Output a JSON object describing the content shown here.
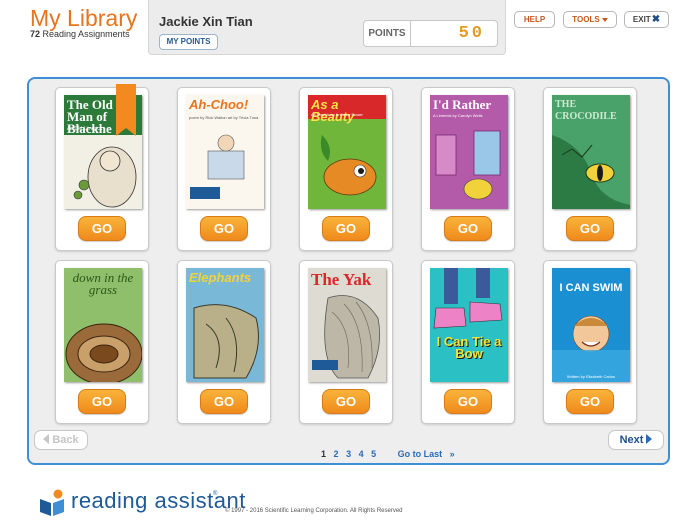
{
  "header": {
    "title": "My Library",
    "assignment_count": "72",
    "assignment_label": "Reading Assignments",
    "user_name": "Jackie Xin Tian",
    "my_points_label": "MY POINTS",
    "points_label": "POINTS",
    "points_value": "50",
    "help_label": "HELP",
    "tools_label": "TOOLS",
    "exit_label": "EXIT"
  },
  "books": [
    {
      "title": "The Old Man of Blackhe",
      "subtitle": "An Old Limerick",
      "go": "GO",
      "bookmarked": true
    },
    {
      "title": "Ah-Choo!",
      "subtitle": "poem by Rick Walton  art by Tricia Tusa",
      "go": "GO"
    },
    {
      "title": "As a Beauty",
      "subtitle": "A Limerick by Anthony Euwer",
      "go": "GO"
    },
    {
      "title": "I'd Rather",
      "subtitle": "A Limerick by Carolyn Wells",
      "go": "GO"
    },
    {
      "title": "THE CROCODILE",
      "subtitle": "",
      "go": "GO"
    },
    {
      "title": "down in the grass",
      "subtitle": "",
      "go": "GO"
    },
    {
      "title": "Elephants",
      "subtitle": "",
      "go": "GO"
    },
    {
      "title": "The Yak",
      "subtitle": "",
      "go": "GO"
    },
    {
      "title": "I Can Tie a Bow",
      "subtitle": "",
      "go": "GO"
    },
    {
      "title": "I CAN SWIM",
      "subtitle": "Written by Elizabeth Carlos",
      "go": "GO"
    }
  ],
  "pagination": {
    "back_label": "Back",
    "next_label": "Next",
    "pages": [
      "1",
      "2",
      "3",
      "4",
      "5"
    ],
    "current_page": "1",
    "go_last_label": "Go to Last",
    "go_last_icon": "»"
  },
  "footer": {
    "brand": "reading assistant",
    "trademark": "®",
    "copyright": "© 1997 - 2016 Scientific Learning Corporation. All Rights Reserved"
  }
}
